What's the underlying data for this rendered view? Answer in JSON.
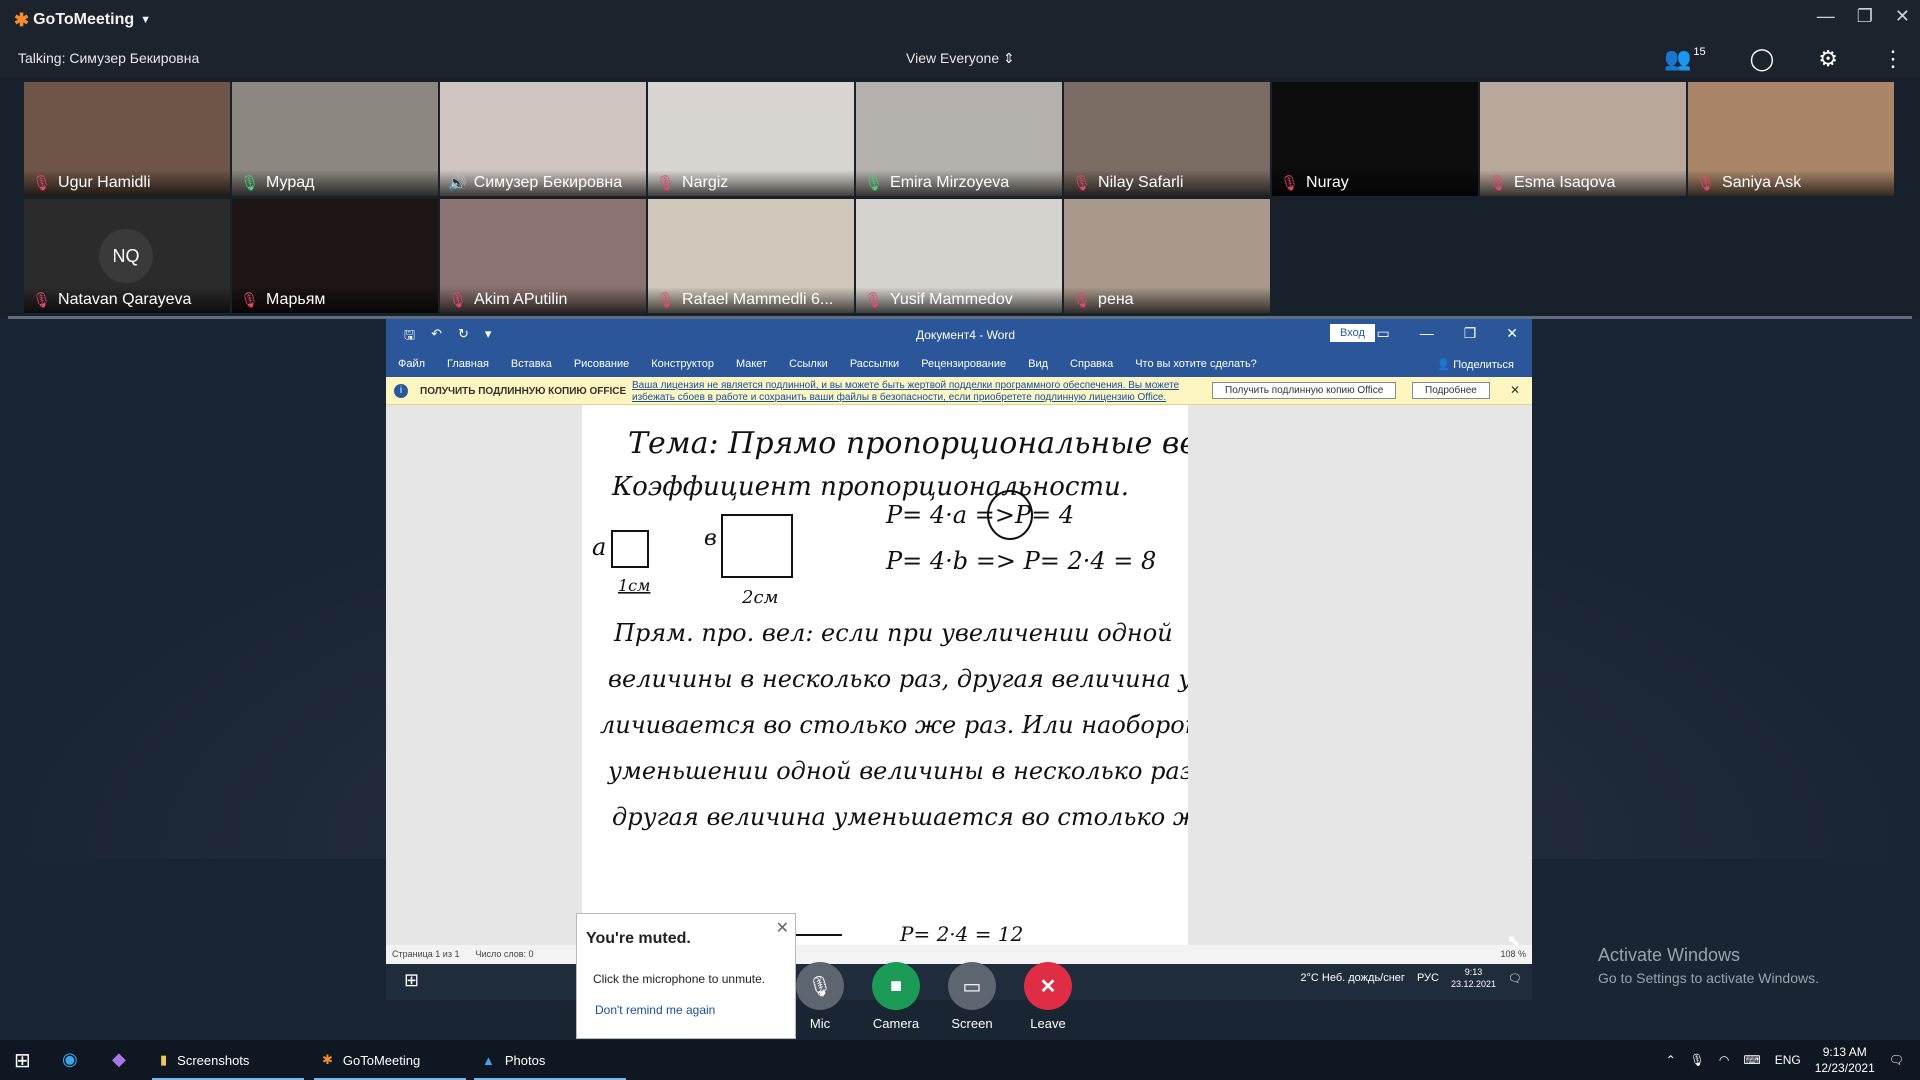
{
  "app": {
    "name": "GoToMeeting",
    "talking": "Talking: Симузер Бекировна",
    "view": "View Everyone",
    "participants_count": "15"
  },
  "participants": [
    {
      "name": "Ugur Hamidli",
      "mic": "off",
      "bg": "#6e5547"
    },
    {
      "name": "Мурад",
      "mic": "on",
      "bg": "#8c8780"
    },
    {
      "name": "Симузер Бекировна",
      "mic": "talk",
      "bg": "#cfc4bf"
    },
    {
      "name": "Nargiz",
      "mic": "off",
      "bg": "#d9d6d1"
    },
    {
      "name": "Emira  Mirzoyeva",
      "mic": "on",
      "bg": "#b4b0ab"
    },
    {
      "name": "Nilay Safarli",
      "mic": "off",
      "bg": "#7a6b63"
    },
    {
      "name": "Nuray",
      "mic": "off",
      "bg": "#0c0c0c"
    },
    {
      "name": "Esma Isaqova",
      "mic": "off",
      "bg": "#b9a89c"
    },
    {
      "name": "Saniya Ask",
      "mic": "off",
      "bg": "#a98668"
    },
    {
      "name": "Natavan Qarayeva",
      "mic": "off",
      "bg": "#2b2b2b",
      "initials": "NQ"
    },
    {
      "name": "Марьям",
      "mic": "off",
      "bg": "#1d1414"
    },
    {
      "name": "Akim APutilin",
      "mic": "off",
      "bg": "#8a7370"
    },
    {
      "name": "Rafael Mammedli 6...",
      "mic": "off",
      "bg": "#d0c8ba"
    },
    {
      "name": "Yusif Mammedov",
      "mic": "off",
      "bg": "#d6d2ce"
    },
    {
      "name": "рена",
      "mic": "off",
      "bg": "#a9998c"
    }
  ],
  "word": {
    "caption": "Документ4  -  Word",
    "login": "Вход",
    "menu": [
      "Файл",
      "Главная",
      "Вставка",
      "Рисование",
      "Конструктор",
      "Макет",
      "Ссылки",
      "Рассылки",
      "Рецензирование",
      "Вид",
      "Справка",
      "Что вы хотите сделать?"
    ],
    "share": "Поделиться",
    "warn_label": "ПОЛУЧИТЬ ПОДЛИННУЮ КОПИЮ OFFICE",
    "warn_msg": "Ваша лицензия не является подлинной, и вы можете быть жертвой подделки программного обеспечения. Вы можете избежать сбоев в работе и сохранить ваши файлы в безопасности, если приобретете подлинную лицензию Office.",
    "warn_btn1": "Получить подлинную копию Office",
    "warn_btn2": "Подробнее",
    "status_page": "Страница 1 из 1",
    "status_words": "Число слов: 0",
    "zoom": "108 %",
    "note": [
      "Тема: Прямо пропорциональные величины.",
      "Коэффициент пропорциональности.",
      "P= 4·a  =>P= 4",
      "P= 4·b  => P= 2·4 = 8",
      "Прям. про. вел: если при увеличении одной",
      "величины в несколько раз, другая величина уве-",
      "личивается во столько же раз. Или наоборот при",
      "уменьшении одной величины в несколько раз,",
      "другая величина уменьшается во столько же",
      "P= 2·4 = 12"
    ],
    "fig_a": "a",
    "fig_a_unit": "1см",
    "fig_b": "в",
    "fig_b_unit": "2см"
  },
  "remote_taskbar": {
    "weather": "2°C  Неб. дождь/снег",
    "lang": "РУС",
    "time": "9:13",
    "date": "23.12.2021"
  },
  "activate": {
    "line1": "Activate Windows",
    "line2": "Go to Settings to activate Windows."
  },
  "controls": [
    {
      "label": "Mic"
    },
    {
      "label": "Camera"
    },
    {
      "label": "Screen"
    },
    {
      "label": "Leave"
    }
  ],
  "muted": {
    "title": "You're muted.",
    "body": "Click the microphone to unmute.",
    "link": "Don't remind me again"
  },
  "taskbar": {
    "apps": [
      "Screenshots",
      "GoToMeeting",
      "Photos"
    ],
    "lang": "ENG",
    "time": "9:13 AM",
    "date": "12/23/2021"
  }
}
